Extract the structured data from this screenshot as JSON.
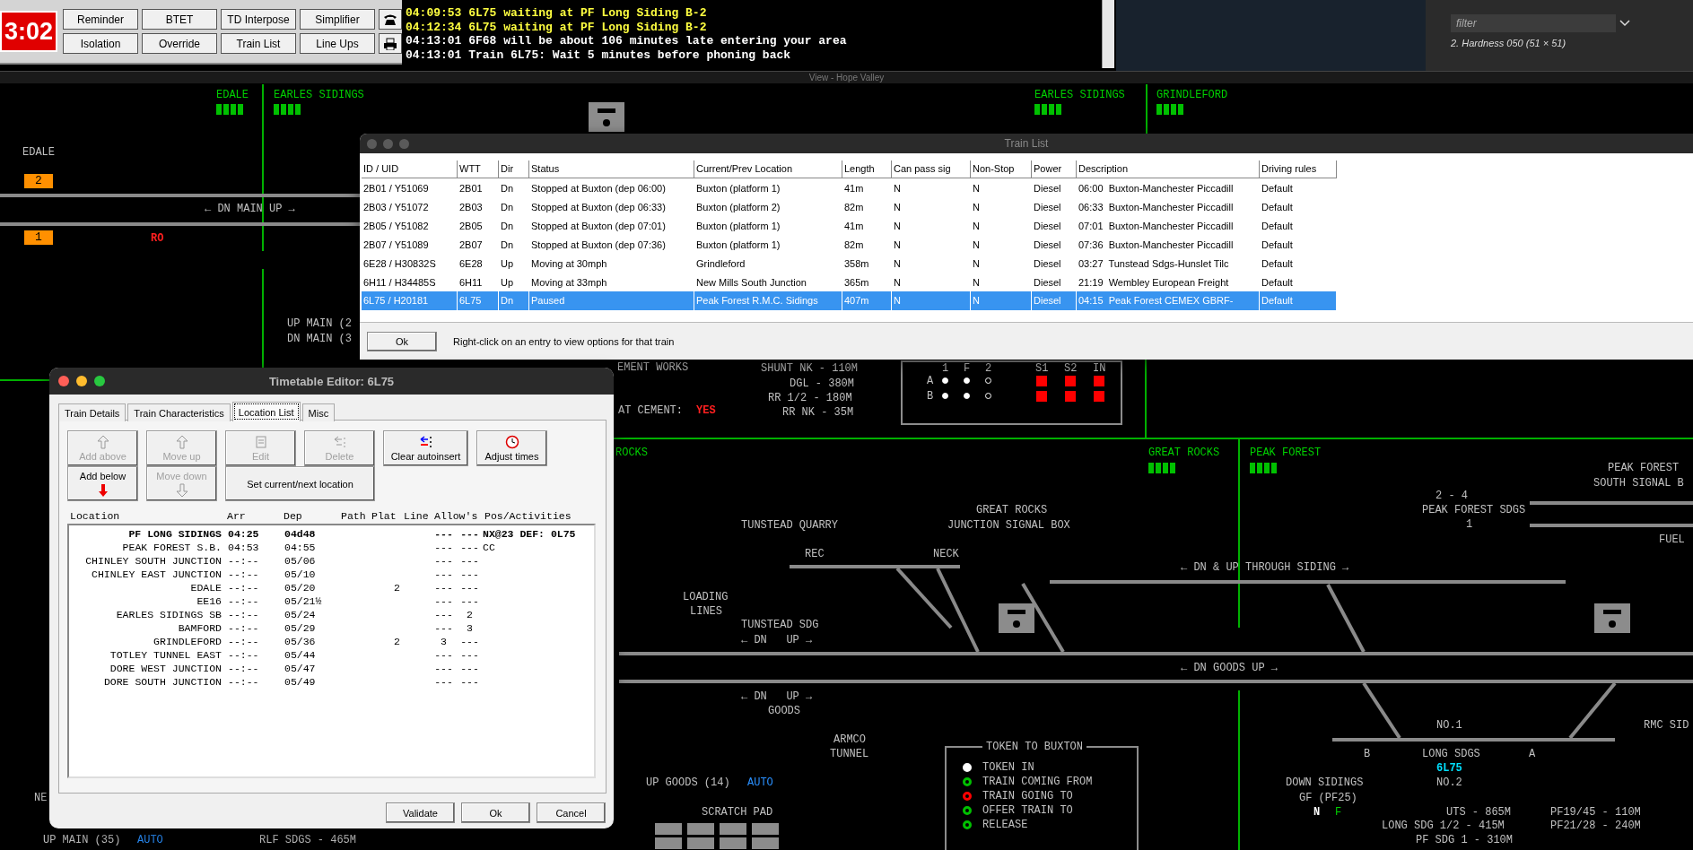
{
  "control_panel": {
    "clock": "3:02",
    "buttons": [
      {
        "label": "Reminder",
        "kind": "text"
      },
      {
        "label": "BTET",
        "kind": "text"
      },
      {
        "label": "TD Interpose",
        "kind": "text"
      },
      {
        "label": "Simplifier",
        "kind": "text"
      },
      {
        "kind": "phone"
      },
      {
        "label": "Isolation",
        "kind": "text"
      },
      {
        "label": "Override",
        "kind": "text"
      },
      {
        "label": "Train List",
        "kind": "text"
      },
      {
        "label": "Line Ups",
        "kind": "text"
      },
      {
        "kind": "printer"
      }
    ]
  },
  "messages": [
    {
      "text": "04:09:53 6L75 waiting at PF Long Siding B-2",
      "kind": "warning"
    },
    {
      "text": "04:12:34 6L75 waiting at PF Long Siding B-2",
      "kind": "warning"
    },
    {
      "text": "04:13:01 6F68 will be about 106 minutes late entering your area",
      "kind": "info"
    },
    {
      "text": "04:13:01 Train 6L75: Wait 5 minutes before phoning back",
      "kind": "info"
    }
  ],
  "side_panel": {
    "filter_placeholder": "filter",
    "layer": "2. Hardness 050 (51 × 51)"
  },
  "view_title": "View - Hope Valley",
  "schematic": {
    "labels": [
      {
        "text": "EDALE",
        "kind": "area"
      },
      {
        "text": "EARLES SIDINGS",
        "kind": "area"
      },
      {
        "text": "EARLES SIDINGS",
        "kind": "area"
      },
      {
        "text": "GRINDLEFORD",
        "kind": "area"
      },
      {
        "text": "EDALE",
        "kind": "label"
      },
      {
        "text": "2",
        "kind": "berth"
      },
      {
        "text": "← DN MAIN UP →",
        "kind": "label"
      },
      {
        "text": "1",
        "kind": "berth"
      },
      {
        "text": "RO",
        "kind": "alert"
      },
      {
        "text": "UP MAIN (2",
        "kind": "label"
      },
      {
        "text": "DN MAIN (3",
        "kind": "label"
      },
      {
        "text": "EMENT WORKS",
        "kind": "label"
      },
      {
        "text": "SHUNT NK - 110M",
        "kind": "label"
      },
      {
        "text": "DGL - 380M",
        "kind": "label"
      },
      {
        "text": "RR 1/2 - 180M",
        "kind": "label"
      },
      {
        "text": "AT CEMENT:",
        "kind": "label"
      },
      {
        "text": "YES",
        "kind": "alert"
      },
      {
        "text": "RR NK - 35M",
        "kind": "label"
      },
      {
        "text": "ROCKS",
        "kind": "area"
      },
      {
        "text": "GREAT ROCKS",
        "kind": "area"
      },
      {
        "text": "PEAK FOREST",
        "kind": "area"
      },
      {
        "text": "PEAK FOREST",
        "kind": "label"
      },
      {
        "text": "SOUTH SIGNAL B",
        "kind": "label"
      },
      {
        "text": "2 - 4",
        "kind": "label"
      },
      {
        "text": "PEAK FOREST SDGS",
        "kind": "label"
      },
      {
        "text": "1",
        "kind": "label"
      },
      {
        "text": "FUEL",
        "kind": "label"
      },
      {
        "text": "GREAT ROCKS",
        "kind": "label"
      },
      {
        "text": "TUNSTEAD QUARRY",
        "kind": "label"
      },
      {
        "text": "JUNCTION SIGNAL BOX",
        "kind": "label"
      },
      {
        "text": "REC",
        "kind": "label"
      },
      {
        "text": "NECK",
        "kind": "label"
      },
      {
        "text": "← DN & UP THROUGH SIDING →",
        "kind": "label"
      },
      {
        "text": "LOADING",
        "kind": "label"
      },
      {
        "text": "LINES",
        "kind": "label"
      },
      {
        "text": "TUNSTEAD SDG",
        "kind": "label"
      },
      {
        "text": "← DN   UP →",
        "kind": "label"
      },
      {
        "text": "← DN GOODS UP →",
        "kind": "label"
      },
      {
        "text": "← DN   UP →",
        "kind": "label"
      },
      {
        "text": "GOODS",
        "kind": "label"
      },
      {
        "text": "NO.1",
        "kind": "label"
      },
      {
        "text": "RMC SID",
        "kind": "label"
      },
      {
        "text": "ARMCO",
        "kind": "label"
      },
      {
        "text": "TUNNEL",
        "kind": "label"
      },
      {
        "text": "B",
        "kind": "label"
      },
      {
        "text": "LONG SDGS",
        "kind": "label"
      },
      {
        "text": "A",
        "kind": "label"
      },
      {
        "text": "6L75",
        "kind": "train"
      },
      {
        "text": "UP GOODS (14)",
        "kind": "label"
      },
      {
        "text": "AUTO",
        "kind": "auto"
      },
      {
        "text": "DOWN SIDINGS",
        "kind": "label"
      },
      {
        "text": "NO.2",
        "kind": "label"
      },
      {
        "text": "NE",
        "kind": "label"
      },
      {
        "text": "GF (PF25)",
        "kind": "label"
      },
      {
        "text": "SCRATCH PAD",
        "kind": "label"
      },
      {
        "text": "N",
        "kind": "white"
      },
      {
        "text": "F",
        "kind": "area"
      },
      {
        "text": "UTS - 865M",
        "kind": "label"
      },
      {
        "text": "PF19/45 - 110M",
        "kind": "label"
      },
      {
        "text": "LONG SDG 1/2 - 415M",
        "kind": "label"
      },
      {
        "text": "PF21/28 - 240M",
        "kind": "label"
      },
      {
        "text": "UP MAIN (35)",
        "kind": "label"
      },
      {
        "text": "AUTO",
        "kind": "auto"
      },
      {
        "text": "RLF SDGS - 465M",
        "kind": "label"
      },
      {
        "text": "PF SDG 1 - 310M",
        "kind": "label"
      }
    ],
    "indicator_grid": {
      "columns": [
        "1",
        "F",
        "2"
      ],
      "rows": [
        {
          "label": "A",
          "lamps": [
            true,
            true,
            false
          ]
        },
        {
          "label": "B",
          "lamps": [
            true,
            true,
            false
          ]
        }
      ],
      "alarms": [
        {
          "label": "S1",
          "lit": true
        },
        {
          "label": "S2",
          "lit": true
        },
        {
          "label": "IN",
          "lit": true
        }
      ]
    },
    "token_panel": {
      "title": "TOKEN TO BUXTON",
      "items": [
        {
          "text": "TOKEN IN",
          "color": "#ffffff",
          "kind": "solid"
        },
        {
          "text": "TRAIN COMING FROM",
          "color": "#00c000",
          "kind": "ring"
        },
        {
          "text": "TRAIN GOING TO",
          "color": "#ff0000",
          "kind": "ring"
        },
        {
          "text": "OFFER TRAIN TO",
          "color": "#00c000",
          "kind": "ring"
        },
        {
          "text": "RELEASE",
          "color": "#00c000",
          "kind": "ring"
        }
      ]
    }
  },
  "train_list": {
    "title": "Train List",
    "columns": [
      "ID / UID",
      "WTT",
      "Dir",
      "Status",
      "Current/Prev Location",
      "Length",
      "Can pass sig",
      "Non-Stop",
      "Power",
      "Description",
      "Driving rules"
    ],
    "rows": [
      {
        "cells": [
          "2B01 / Y51069",
          "2B01",
          "Dn",
          "Stopped at Buxton (dep 06:00)",
          "Buxton (platform 1)",
          "41m",
          "N",
          "N",
          "Diesel",
          "06:00  Buxton-Manchester Piccadill",
          "Default"
        ],
        "selected": false
      },
      {
        "cells": [
          "2B03 / Y51072",
          "2B03",
          "Dn",
          "Stopped at Buxton (dep 06:33)",
          "Buxton (platform 2)",
          "82m",
          "N",
          "N",
          "Diesel",
          "06:33  Buxton-Manchester Piccadill",
          "Default"
        ],
        "selected": false
      },
      {
        "cells": [
          "2B05 / Y51082",
          "2B05",
          "Dn",
          "Stopped at Buxton (dep 07:01)",
          "Buxton (platform 1)",
          "41m",
          "N",
          "N",
          "Diesel",
          "07:01  Buxton-Manchester Piccadill",
          "Default"
        ],
        "selected": false
      },
      {
        "cells": [
          "2B07 / Y51089",
          "2B07",
          "Dn",
          "Stopped at Buxton (dep 07:36)",
          "Buxton (platform 1)",
          "82m",
          "N",
          "N",
          "Diesel",
          "07:36  Buxton-Manchester Piccadill",
          "Default"
        ],
        "selected": false
      },
      {
        "cells": [
          "6E28 / H30832S",
          "6E28",
          "Up",
          "Moving at 30mph",
          "Grindleford",
          "358m",
          "N",
          "N",
          "Diesel",
          "03:27  Tunstead Sdgs-Hunslet Tilc",
          "Default"
        ],
        "selected": false
      },
      {
        "cells": [
          "6H11 / H34485S",
          "6H11",
          "Up",
          "Moving at 33mph",
          "New Mills South Junction",
          "365m",
          "N",
          "N",
          "Diesel",
          "21:19  Wembley European Freight",
          "Default"
        ],
        "selected": false
      },
      {
        "cells": [
          "6L75 / H20181",
          "6L75",
          "Dn",
          "Paused",
          "Peak Forest R.M.C. Sidings",
          "407m",
          "N",
          "N",
          "Diesel",
          "04:15  Peak Forest CEMEX GBRF-",
          "Default"
        ],
        "selected": true
      }
    ],
    "ok": "Ok",
    "hint": "Right-click on an entry to view options for that train"
  },
  "timetable_editor": {
    "title": "Timetable Editor: 6L75",
    "tabs": [
      {
        "label": "Train Details",
        "selected": false
      },
      {
        "label": "Train Characteristics",
        "selected": false
      },
      {
        "label": "Location List",
        "selected": true
      },
      {
        "label": "Misc",
        "selected": false
      }
    ],
    "buttons": [
      {
        "label": "Add above",
        "kind": "add-above",
        "disabled": true
      },
      {
        "label": "Move up",
        "kind": "move-up",
        "disabled": true
      },
      {
        "label": "Edit",
        "kind": "edit",
        "disabled": true
      },
      {
        "label": "Delete",
        "kind": "delete",
        "disabled": true
      },
      {
        "label": "Clear autoinsert",
        "kind": "clear-autoinsert",
        "disabled": false
      },
      {
        "label": "Adjust times",
        "kind": "adjust-times",
        "disabled": false
      },
      {
        "label": "Add below",
        "kind": "add-below",
        "disabled": false
      },
      {
        "label": "Move down",
        "kind": "move-down",
        "disabled": true
      },
      {
        "label": "Set current/next location",
        "kind": "set-current",
        "disabled": false
      }
    ],
    "columns": [
      "Location",
      "Arr",
      "Dep",
      "Path",
      "Plat",
      "Line",
      "Allow's",
      "Pos/Activities"
    ],
    "rows": [
      {
        "location": "PF LONG SIDINGS",
        "arr": "04:25",
        "dep": "04d48",
        "line": "",
        "allow_1": "---",
        "allow_2": "---",
        "activities": "NX@23 DEF: 0L75",
        "current": true
      },
      {
        "location": "PEAK FOREST S.B.",
        "arr": "04:53",
        "dep": "04:55",
        "line": "",
        "allow_1": "---",
        "allow_2": "---",
        "activities": "CC",
        "current": false
      },
      {
        "location": "CHINLEY SOUTH JUNCTION",
        "arr": "--:--",
        "dep": "05/06",
        "line": "",
        "allow_1": "---",
        "allow_2": "---",
        "activities": "",
        "current": false
      },
      {
        "location": "CHINLEY EAST JUNCTION",
        "arr": "--:--",
        "dep": "05/10",
        "line": "",
        "allow_1": "---",
        "allow_2": "---",
        "activities": "",
        "current": false
      },
      {
        "location": "EDALE",
        "arr": "--:--",
        "dep": "05/20",
        "line": "2",
        "allow_1": "---",
        "allow_2": "---",
        "activities": "",
        "current": false
      },
      {
        "location": "EE16",
        "arr": "--:--",
        "dep": "05/21½",
        "line": "",
        "allow_1": "---",
        "allow_2": "---",
        "activities": "",
        "current": false
      },
      {
        "location": "EARLES SIDINGS SB",
        "arr": "--:--",
        "dep": "05/24",
        "line": "",
        "allow_1": "---",
        "allow_2": "2",
        "activities": "",
        "current": false
      },
      {
        "location": "BAMFORD",
        "arr": "--:--",
        "dep": "05/29",
        "line": "",
        "allow_1": "---",
        "allow_2": "3",
        "activities": "",
        "current": false
      },
      {
        "location": "GRINDLEFORD",
        "arr": "--:--",
        "dep": "05/36",
        "line": "2",
        "allow_1": "3",
        "allow_2": "---",
        "activities": "",
        "current": false
      },
      {
        "location": "TOTLEY TUNNEL EAST",
        "arr": "--:--",
        "dep": "05/44",
        "line": "",
        "allow_1": "---",
        "allow_2": "---",
        "activities": "",
        "current": false
      },
      {
        "location": "DORE WEST JUNCTION",
        "arr": "--:--",
        "dep": "05/47",
        "line": "",
        "allow_1": "---",
        "allow_2": "---",
        "activities": "",
        "current": false
      },
      {
        "location": "DORE SOUTH JUNCTION",
        "arr": "--:--",
        "dep": "05/49",
        "line": "",
        "allow_1": "---",
        "allow_2": "---",
        "activities": "",
        "current": false
      }
    ],
    "footer_buttons": [
      "Validate",
      "Ok",
      "Cancel"
    ]
  }
}
